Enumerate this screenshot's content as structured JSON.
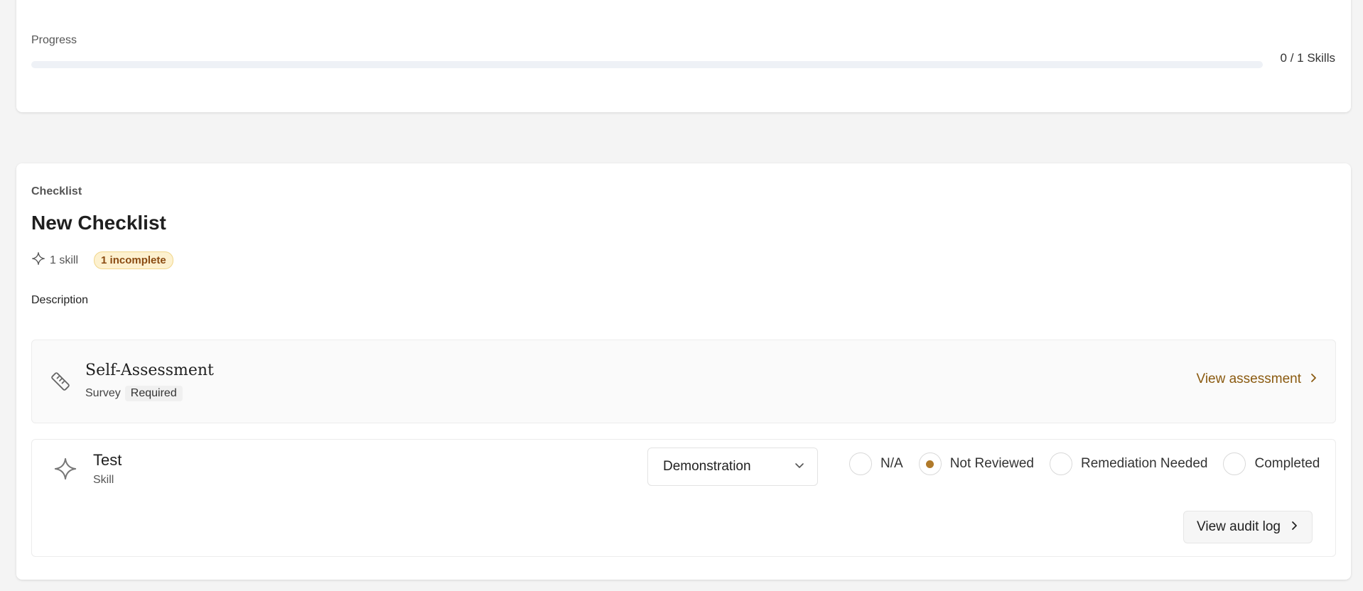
{
  "progress": {
    "label": "Progress",
    "count": "0 / 1 Skills",
    "fraction": 0
  },
  "checklist": {
    "section_label": "Checklist",
    "title": "New Checklist",
    "skill_count": "1 skill",
    "incomplete_badge": "1 incomplete",
    "description_label": "Description"
  },
  "assessment": {
    "title": "Self-Assessment",
    "type": "Survey",
    "tag": "Required",
    "link": "View assessment",
    "icon": "ruler-icon"
  },
  "skill": {
    "name": "Test",
    "kind": "Skill",
    "icon": "sparkle-icon",
    "select_value": "Demonstration",
    "statuses": [
      {
        "label": "N/A",
        "selected": false
      },
      {
        "label": "Not Reviewed",
        "selected": true
      },
      {
        "label": "Remediation Needed",
        "selected": false
      },
      {
        "label": "Completed",
        "selected": false
      }
    ],
    "audit_button": "View audit log"
  },
  "colors": {
    "accent": "#b07a2a",
    "link": "#8a5a10",
    "badge_bg": "#fdf1cf",
    "badge_text": "#8a4b12"
  }
}
